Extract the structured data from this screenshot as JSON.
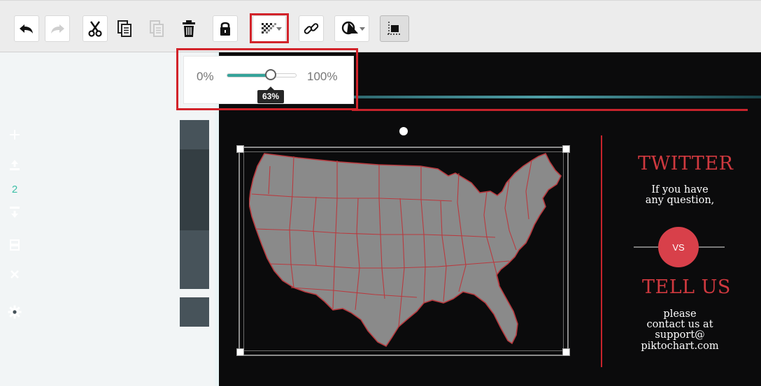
{
  "toolbar": {
    "buttons": [
      {
        "id": "undo",
        "icon": "undo-icon",
        "enabled": true
      },
      {
        "id": "redo",
        "icon": "redo-icon",
        "enabled": false
      },
      {
        "id": "cut",
        "icon": "scissors-icon",
        "enabled": true
      },
      {
        "id": "copy",
        "icon": "copy-icon",
        "enabled": true
      },
      {
        "id": "paste",
        "icon": "paste-icon",
        "enabled": false
      },
      {
        "id": "delete",
        "icon": "trash-icon",
        "enabled": true
      },
      {
        "id": "lock",
        "icon": "lock-icon",
        "enabled": true
      },
      {
        "id": "transparency",
        "icon": "transparency-icon",
        "enabled": true,
        "highlighted": true
      },
      {
        "id": "link",
        "icon": "link-icon",
        "enabled": true
      },
      {
        "id": "shape-mask",
        "icon": "shape-icon",
        "enabled": true
      },
      {
        "id": "arrange",
        "icon": "align-icon",
        "enabled": true,
        "active": true
      }
    ]
  },
  "opacity_popup": {
    "min_label": "0%",
    "max_label": "100%",
    "value": 63,
    "tooltip": "63%"
  },
  "side_toolbar": {
    "layer_number": "2",
    "icons": [
      "plus-icon",
      "bring-forward-icon",
      "send-backward-icon",
      "duplicate-icon",
      "close-icon",
      "gear-icon"
    ]
  },
  "slide": {
    "map_fill": "#8a8a8a",
    "map_border": "#b93a3f",
    "right_column": {
      "heading1": "TWITTER",
      "text1_line1": "If you have",
      "text1_line2": "any question,",
      "vs_label": "VS",
      "heading2": "TELL US",
      "text2_line1": "please",
      "text2_line2": "contact us at",
      "text2_line3": "support@",
      "text2_line4": "piktochart.com"
    }
  },
  "colors": {
    "highlight_red": "#d2232a",
    "accent_teal": "#35a39a",
    "slide_bg": "#0b0b0c",
    "title_red": "#d0393f"
  }
}
